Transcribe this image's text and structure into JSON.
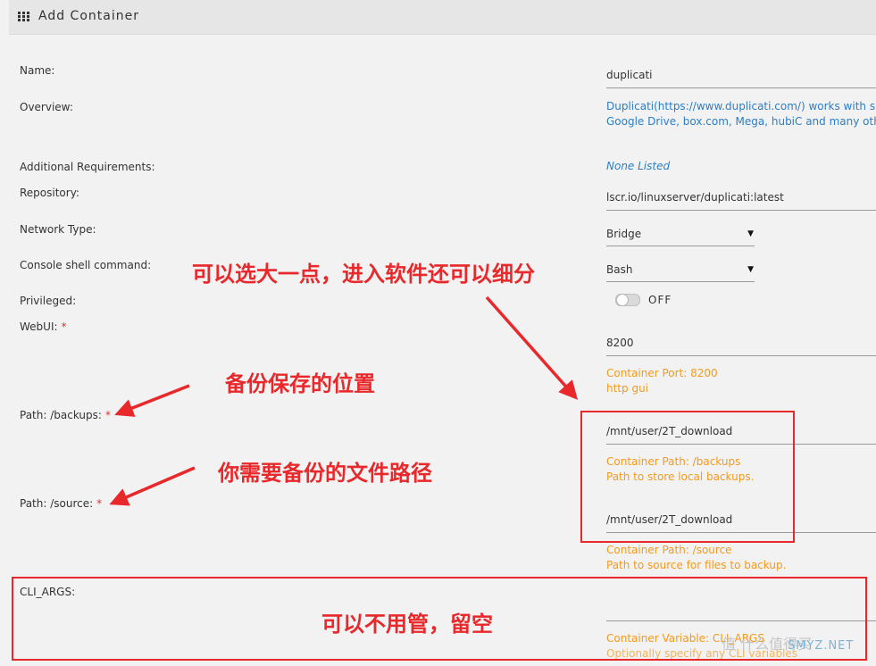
{
  "header": {
    "title": "Add Container",
    "icon": "grid-icon"
  },
  "form": {
    "name": {
      "label": "Name:",
      "value": "duplicati"
    },
    "overview": {
      "label": "Overview:",
      "line1": "Duplicati(https://www.duplicati.com/) works with s",
      "line2": "Google Drive, box.com, Mega, hubiC and many other"
    },
    "additional": {
      "label": "Additional Requirements:",
      "value": "None Listed"
    },
    "repository": {
      "label": "Repository:",
      "value": "lscr.io/linuxserver/duplicati:latest"
    },
    "network": {
      "label": "Network Type:",
      "value": "Bridge"
    },
    "console": {
      "label": "Console shell command:",
      "value": "Bash"
    },
    "privileged": {
      "label": "Privileged:",
      "state": "OFF"
    },
    "webui": {
      "label": "WebUI:",
      "required": "*",
      "value": "8200",
      "note1": "Container Port: 8200",
      "note2": "http gui"
    },
    "backups": {
      "label": "Path: /backups:",
      "required": "*",
      "value": "/mnt/user/2T_download",
      "note1": "Container Path: /backups",
      "note2": "Path to store local backups."
    },
    "source": {
      "label": "Path: /source:",
      "required": "*",
      "value": "/mnt/user/2T_download",
      "note1": "Container Path: /source",
      "note2": "Path to source for files to backup."
    },
    "cli": {
      "label": "CLI_ARGS:",
      "value": "",
      "note1": "Container Variable: CLI_ARGS",
      "note2": "Optionally specify any CLI variables"
    }
  },
  "annotations": {
    "console": "可以选大一点，进入软件还可以细分",
    "backups": "备份保存的位置",
    "source": "你需要备份的文件路径",
    "cli": "可以不用管，留空"
  },
  "watermark": {
    "cn": "值 什么值得买",
    "en": "SMYZ.NET"
  },
  "colors": {
    "annotation": "#e8282a",
    "link": "#2b7ec7",
    "note": "#f39a1e",
    "background": "#f2f2f2"
  }
}
